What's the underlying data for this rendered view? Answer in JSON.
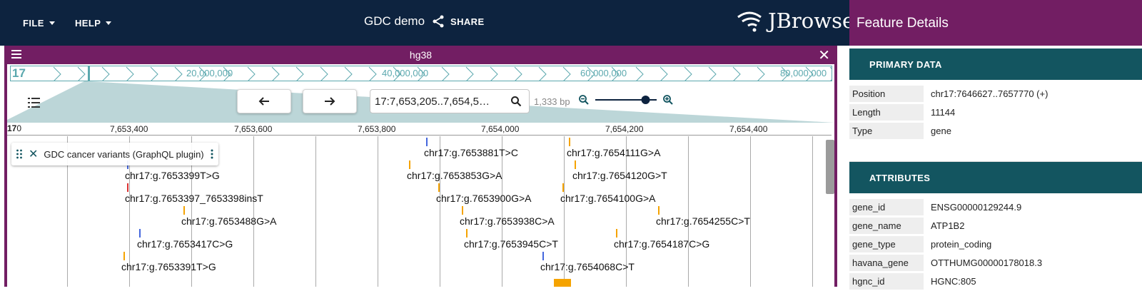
{
  "appbar": {
    "file_label": "FILE",
    "help_label": "HELP",
    "session_name": "GDC demo",
    "share_label": "SHARE",
    "logo_text": "JBrowse"
  },
  "view": {
    "title": "hg38",
    "overview": {
      "chr": "17",
      "labels": [
        "20,000,000",
        "40,000,000",
        "60,000,000",
        "80,000,000"
      ]
    },
    "location": "17:7,653,205..7,654,5…",
    "bp_label": "1,333 bp",
    "zoom_level_fraction": 0.82,
    "ruler": {
      "chr": "17",
      "start": "0",
      "labels": [
        "7,653,400",
        "7,653,600",
        "7,653,800",
        "7,654,000",
        "7,654,200",
        "7,654,400"
      ]
    },
    "track_name": "GDC cancer variants (GraphQL plugin)",
    "features": [
      {
        "label": "chr17:g.7653881T>C",
        "color": "#4466dd"
      },
      {
        "label": "chr17:g.7654111G>A",
        "color": "#f5a300"
      },
      {
        "label": "chr17:g.7653399T>G",
        "color": "#4466dd"
      },
      {
        "label": "chr17:g.7653853G>A",
        "color": "#f5a300"
      },
      {
        "label": "chr17:g.7654120G>T",
        "color": "#f5a300"
      },
      {
        "label": "chr17:g.7653397_7653398insT",
        "color": "#dd3333"
      },
      {
        "label": "chr17:g.7653900G>A",
        "color": "#f5a300"
      },
      {
        "label": "chr17:g.7654100G>A",
        "color": "#f5a300"
      },
      {
        "label": "chr17:g.7653488G>A",
        "color": "#f5a300"
      },
      {
        "label": "chr17:g.7653938C>A",
        "color": "#f5a300"
      },
      {
        "label": "chr17:g.7654255C>T",
        "color": "#f5a300"
      },
      {
        "label": "chr17:g.7653417C>G",
        "color": "#4466dd"
      },
      {
        "label": "chr17:g.7653945C>T",
        "color": "#f5a300"
      },
      {
        "label": "chr17:g.7654187C>G",
        "color": "#f5a300"
      },
      {
        "label": "chr17:g.7654068C>T",
        "color": "#4466dd"
      },
      {
        "label": "chr17:g.7653391T>G",
        "color": "#f5a300"
      }
    ]
  },
  "drawer": {
    "title": "Feature Details",
    "primary_heading": "PRIMARY DATA",
    "primary": [
      {
        "key": "Position",
        "value": "chr17:7646627..7657770 (+)"
      },
      {
        "key": "Length",
        "value": "11144"
      },
      {
        "key": "Type",
        "value": "gene"
      }
    ],
    "attributes_heading": "ATTRIBUTES",
    "attributes": [
      {
        "key": "gene_id",
        "value": "ENSG00000129244.9"
      },
      {
        "key": "gene_name",
        "value": "ATP1B2"
      },
      {
        "key": "gene_type",
        "value": "protein_coding"
      },
      {
        "key": "havana_gene",
        "value": "OTTHUMG00000178018.3"
      },
      {
        "key": "hgnc_id",
        "value": "HGNC:805"
      }
    ]
  },
  "colors": {
    "appbar": "#0d233f",
    "accent": "#721e63",
    "section": "#135560",
    "overview": "#5ba8ae"
  }
}
